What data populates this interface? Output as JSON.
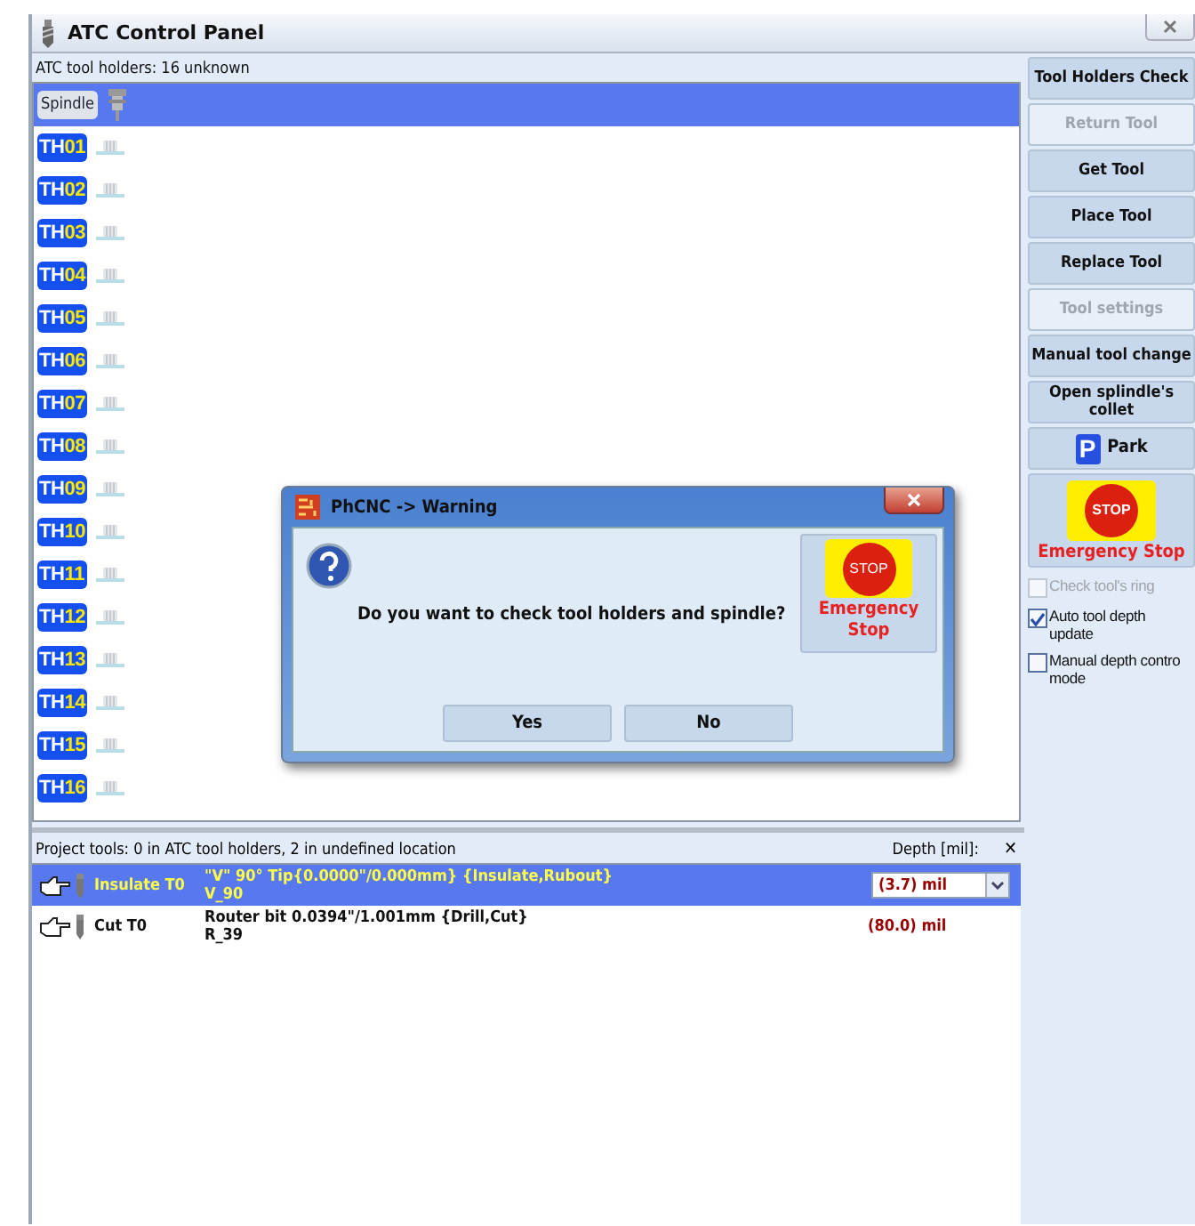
{
  "window": {
    "title": "ATC Control Panel"
  },
  "holders": {
    "header": "ATC tool holders: 16 unknown",
    "spindle": {
      "label": "Spindle",
      "selected": true
    },
    "items": [
      {
        "prefix": "TH",
        "number": "01",
        "selected": false
      },
      {
        "prefix": "TH",
        "number": "02",
        "selected": false
      },
      {
        "prefix": "TH",
        "number": "03",
        "selected": false
      },
      {
        "prefix": "TH",
        "number": "04",
        "selected": false
      },
      {
        "prefix": "TH",
        "number": "05",
        "selected": false
      },
      {
        "prefix": "TH",
        "number": "06",
        "selected": false
      },
      {
        "prefix": "TH",
        "number": "07",
        "selected": false
      },
      {
        "prefix": "TH",
        "number": "08",
        "selected": false
      },
      {
        "prefix": "TH",
        "number": "09",
        "selected": false
      },
      {
        "prefix": "TH",
        "number": "10",
        "selected": false
      },
      {
        "prefix": "TH",
        "number": "11",
        "selected": false
      },
      {
        "prefix": "TH",
        "number": "12",
        "selected": false
      },
      {
        "prefix": "TH",
        "number": "13",
        "selected": false
      },
      {
        "prefix": "TH",
        "number": "14",
        "selected": false
      },
      {
        "prefix": "TH",
        "number": "15",
        "selected": false
      },
      {
        "prefix": "TH",
        "number": "16",
        "selected": false
      }
    ]
  },
  "project_tools": {
    "header": "Project tools: 0 in ATC tool holders, 2 in undefined location",
    "depth_label": "Depth [mil]:",
    "close": "✕",
    "rows": [
      {
        "name": "Insulate T0",
        "description": "\"V\" 90° Tip{0.0000\"/0.000mm} {Insulate,Rubout}",
        "code": "V_90",
        "depth": "(3.7) mil",
        "selected": true
      },
      {
        "name": "Cut T0",
        "description": "Router bit 0.0394\"/1.001mm {Drill,Cut}",
        "code": "R_39",
        "depth": "(80.0) mil",
        "selected": false
      }
    ]
  },
  "side_buttons": [
    {
      "kind": "text",
      "label": "Tool Holders Check",
      "disabled": false
    },
    {
      "kind": "text",
      "label": "Return Tool",
      "disabled": true
    },
    {
      "kind": "text",
      "label": "Get Tool",
      "disabled": false
    },
    {
      "kind": "text",
      "label": "Place Tool",
      "disabled": false
    },
    {
      "kind": "text",
      "label": "Replace Tool",
      "disabled": false
    },
    {
      "kind": "text",
      "label": "Tool settings",
      "disabled": true
    },
    {
      "kind": "text",
      "label": "Manual tool change",
      "disabled": false
    },
    {
      "kind": "text",
      "label": "Open splindle's collet",
      "disabled": false
    },
    {
      "kind": "park",
      "label": "Park",
      "icon_text": "P",
      "disabled": false
    },
    {
      "kind": "stop",
      "label": "Emergency Stop",
      "icon_text": "STOP",
      "disabled": false
    }
  ],
  "options": [
    {
      "label": "Check tool's ring",
      "checked": false,
      "disabled": true
    },
    {
      "label": "Auto tool depth update",
      "checked": true,
      "disabled": false
    },
    {
      "label": "Manual depth contro mode",
      "checked": false,
      "disabled": false
    }
  ],
  "dialog": {
    "title": "PhCNC -> Warning",
    "message": "Do you want to check tool holders and spindle?",
    "stop_button": {
      "icon_text": "STOP",
      "label": "Emergency Stop"
    },
    "buttons": [
      "Yes",
      "No"
    ]
  }
}
